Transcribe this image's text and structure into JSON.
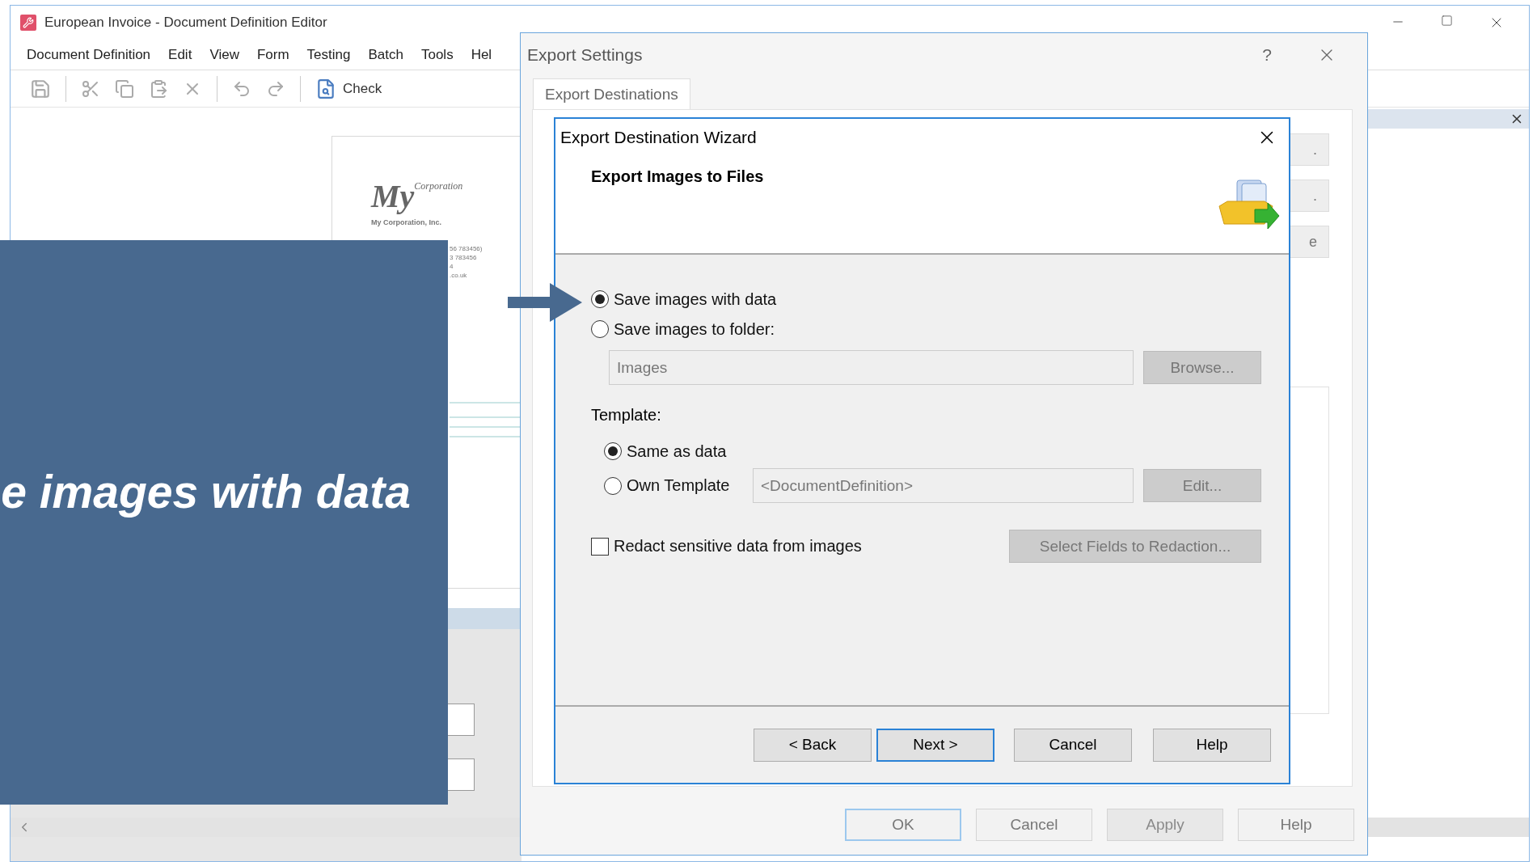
{
  "main_window": {
    "title": "European Invoice - Document Definition Editor",
    "menu": [
      "Document Definition",
      "Edit",
      "View",
      "Form",
      "Testing",
      "Batch",
      "Tools",
      "Hel"
    ],
    "toolbar": {
      "check_label": "Check"
    },
    "document_preview": {
      "logo_word": "My",
      "logo_tagline": "Corporation",
      "company": "My Corporation, Inc.",
      "lines": [
        "56 783456)",
        "3 783456",
        "4",
        ".co.uk"
      ]
    }
  },
  "export_settings": {
    "title": "Export Settings",
    "help": "?",
    "tabs": [
      {
        "label": "Export Destinations",
        "selected": true
      }
    ],
    "side_buttons": [
      ".",
      ".",
      "e"
    ],
    "buttons": [
      {
        "label": "OK",
        "default": true,
        "disabled": false
      },
      {
        "label": "Cancel",
        "default": false,
        "disabled": false
      },
      {
        "label": "Apply",
        "default": false,
        "disabled": true
      },
      {
        "label": "Help",
        "default": false,
        "disabled": false
      }
    ]
  },
  "wizard": {
    "title": "Export Destination Wizard",
    "heading": "Export Images to Files",
    "destination_options": [
      {
        "label": "Save images with data",
        "selected": true
      },
      {
        "label": "Save images to folder:",
        "selected": false
      }
    ],
    "folder_field": {
      "value": "Images",
      "disabled": true
    },
    "browse_button": {
      "label": "Browse...",
      "disabled": true
    },
    "template_label": "Template:",
    "template_options": [
      {
        "label": "Same as data",
        "selected": true
      },
      {
        "label": "Own Template",
        "selected": false
      }
    ],
    "template_field": {
      "value": "<DocumentDefinition>",
      "disabled": true
    },
    "edit_button": {
      "label": "Edit...",
      "disabled": true
    },
    "redact": {
      "label": "Redact sensitive data from images",
      "checked": false
    },
    "select_fields_button": {
      "label": "Select Fields to Redaction...",
      "disabled": true
    },
    "buttons": [
      {
        "label": "< Back",
        "default": false
      },
      {
        "label": "Next >",
        "default": true
      },
      {
        "label": "Cancel",
        "default": false
      },
      {
        "label": "Help",
        "default": false
      }
    ]
  },
  "overlay": {
    "caption": "e images with data"
  }
}
